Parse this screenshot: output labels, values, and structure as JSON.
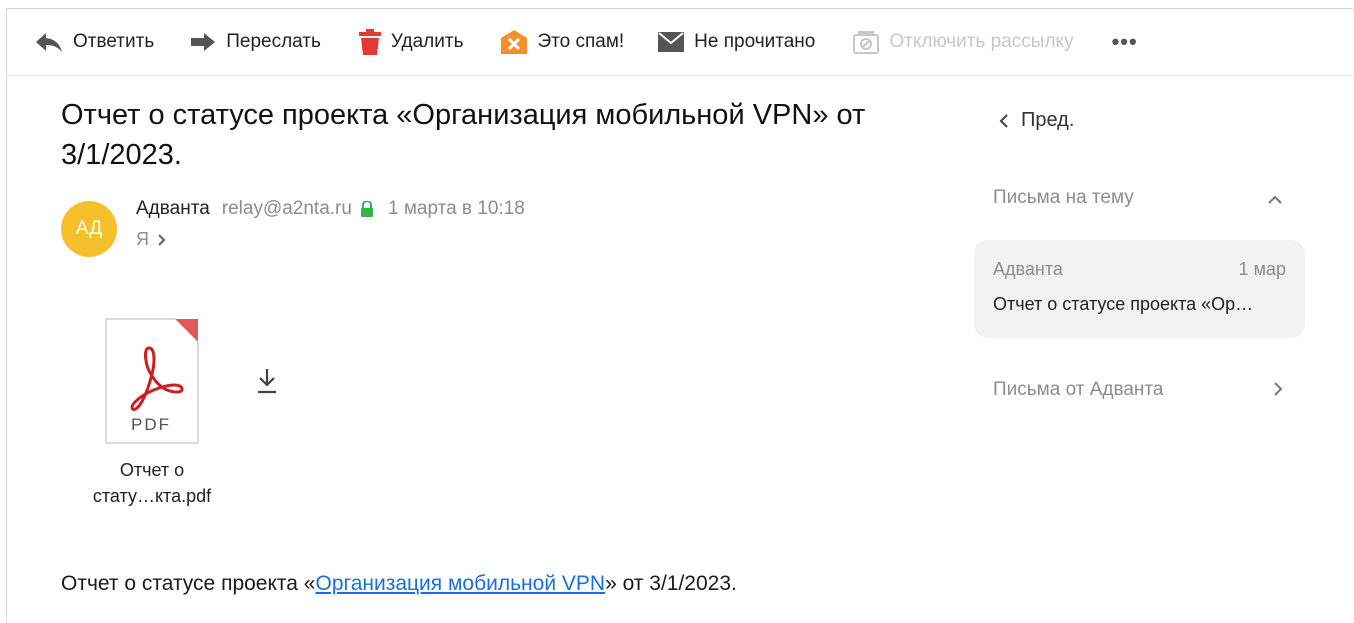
{
  "toolbar": {
    "reply": "Ответить",
    "forward": "Переслать",
    "delete": "Удалить",
    "spam": "Это спам!",
    "unread": "Не прочитано",
    "unsubscribe": "Отключить рассылку",
    "more": "•••"
  },
  "message": {
    "subject": "Отчет о статусе проекта «Организация мобильной VPN» от 3/1/2023.",
    "sender": {
      "initials": "АД",
      "name": "Адванта",
      "email": "relay@a2nta.ru",
      "date": "1 марта в 10:18",
      "recipient": "Я"
    },
    "attachment": {
      "type_label": "PDF",
      "name_line1": "Отчет о",
      "name_line2": "стату…кта.pdf"
    },
    "body": {
      "prefix": "Отчет о статусе проекта «",
      "link": "Организация мобильной VPN",
      "suffix": "» от 3/1/2023."
    }
  },
  "sidebar": {
    "prev": "Пред.",
    "thread_header": "Письма на тему",
    "thread_item": {
      "from": "Адванта",
      "date": "1 мар",
      "subject": "Отчет о статусе проекта «Ор…"
    },
    "from_sender": "Письма от Адванта"
  },
  "colors": {
    "avatar": "#f6c02c",
    "delete_icon": "#e53935",
    "spam_icon": "#f0912d",
    "lock_icon": "#33b34a",
    "link": "#1a6fdf",
    "pdf_red": "#cc1f1f"
  }
}
